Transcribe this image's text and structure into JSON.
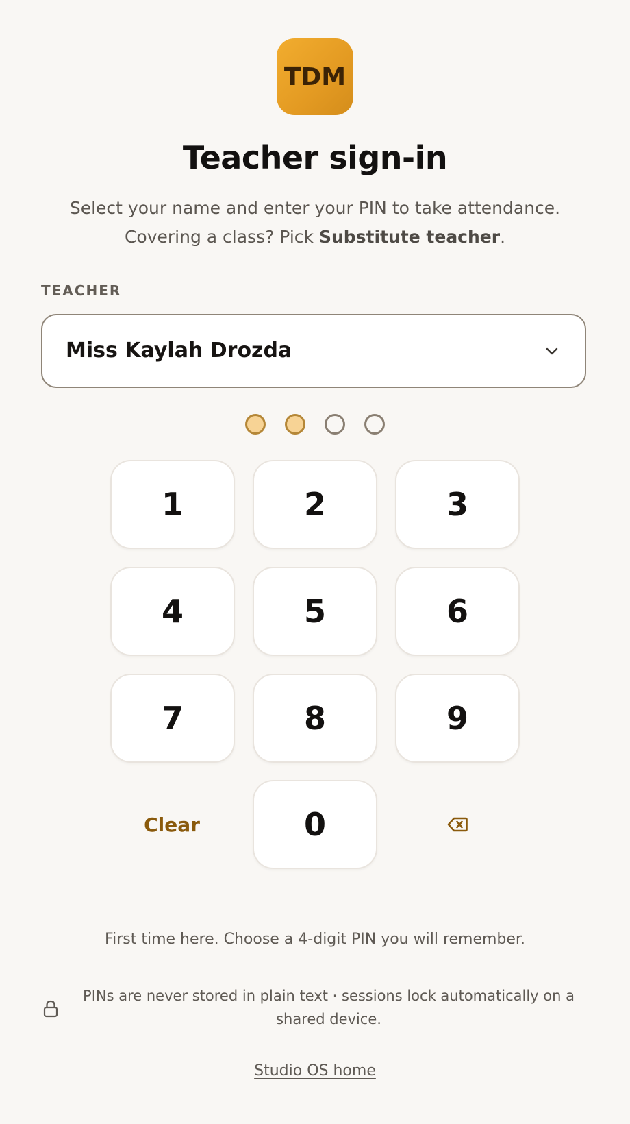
{
  "logo": {
    "text": "TDM",
    "gradient_start": "#f2ad2f",
    "gradient_end": "#d48d1b"
  },
  "page": {
    "title": "Teacher sign-in",
    "subtitle_line1": "Select your name and enter your PIN to take attendance.",
    "subtitle_line2_prefix": "Covering a class? Pick ",
    "subtitle_line2_bold": "Substitute teacher",
    "subtitle_line2_suffix": "."
  },
  "teacher_field": {
    "label": "TEACHER",
    "selected_value": "Miss Kaylah Drozda",
    "icon": "chevron-down-icon"
  },
  "pin": {
    "length": 4,
    "entered_count": 2
  },
  "keypad": {
    "keys": [
      "1",
      "2",
      "3",
      "4",
      "5",
      "6",
      "7",
      "8",
      "9"
    ],
    "zero": "0",
    "clear_label": "Clear",
    "backspace_icon": "backspace-icon"
  },
  "footer": {
    "hint": "First time here. Choose a 4-digit PIN you will remember.",
    "security_icon": "lock-icon",
    "security_text": "PINs are never stored in plain text · sessions lock automatically on a shared device.",
    "home_link": "Studio OS home"
  },
  "colors": {
    "background": "#f9f7f4",
    "accent": "#8a5a0c",
    "dot_filled": "#f7d395",
    "dot_filled_border": "#b58737",
    "dot_empty_border": "#8a7f72"
  }
}
